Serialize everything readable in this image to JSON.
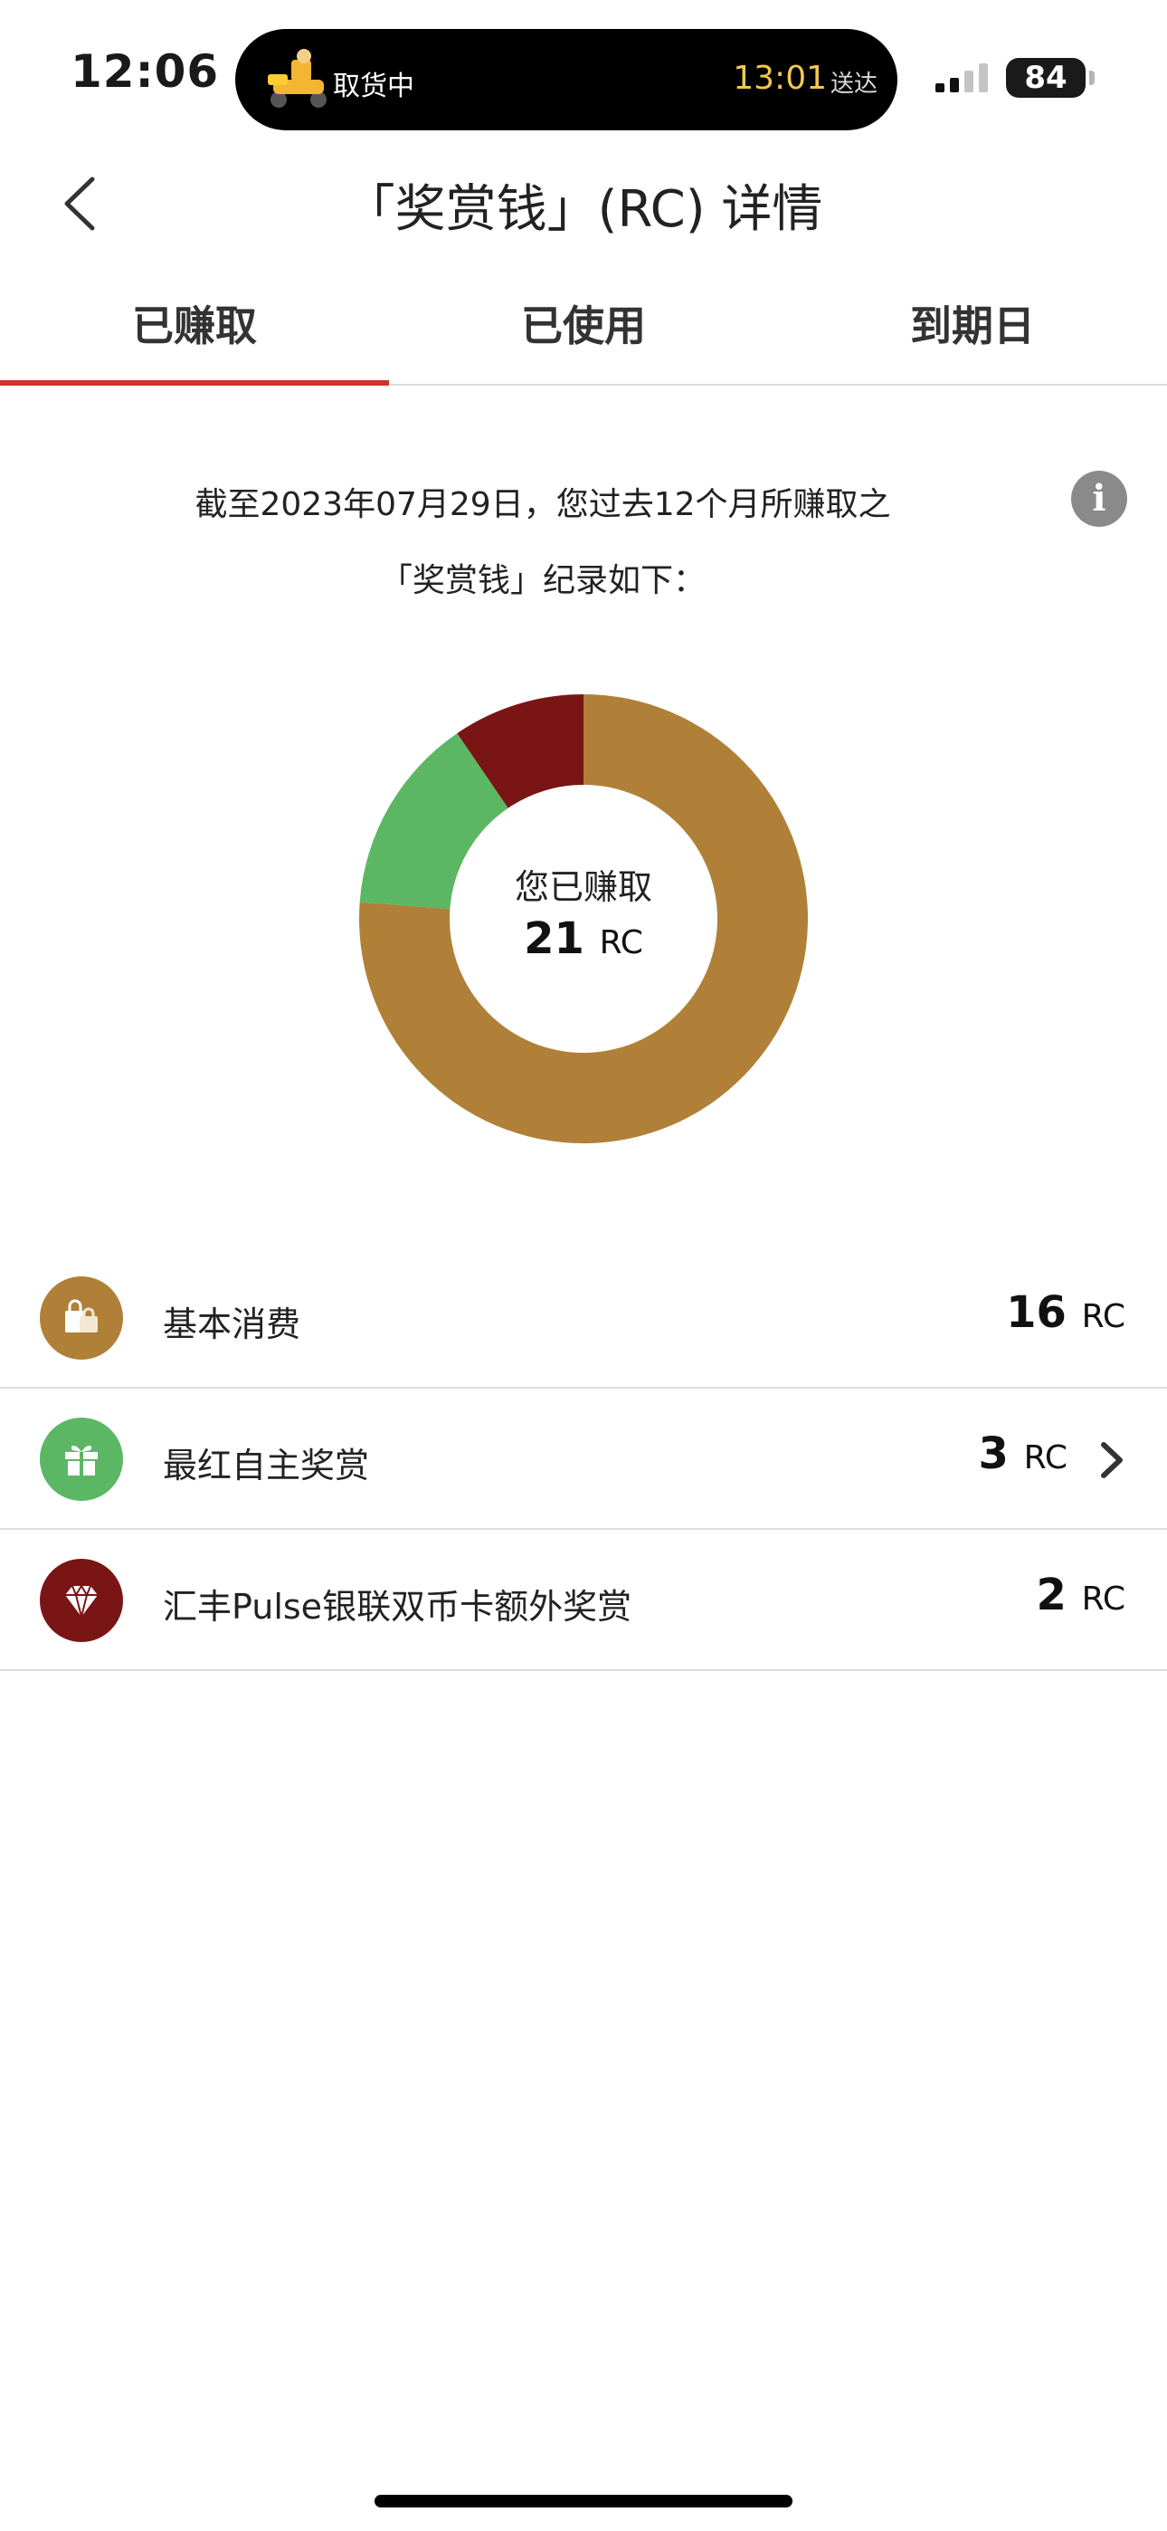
{
  "status_bar": {
    "time": "12:06",
    "activity_text": "取货中",
    "activity_time": "13:01",
    "activity_sub": "送达",
    "battery": "84"
  },
  "header": {
    "title": "「奖赏钱」(RC) 详情",
    "back_icon": "chevron-left-icon"
  },
  "tabs": [
    {
      "label": "已赚取",
      "active": true
    },
    {
      "label": "已使用",
      "active": false
    },
    {
      "label": "到期日",
      "active": false
    }
  ],
  "description": {
    "line1": "截至2023年07月29日，您过去12个月所赚取之",
    "line2": "「奖赏钱」纪录如下：",
    "info_icon": "info-icon"
  },
  "summary": {
    "label": "您已赚取",
    "value": "21",
    "unit": "RC"
  },
  "chart_data": {
    "type": "pie",
    "categories": [
      "基本消费",
      "最红自主奖赏",
      "汇丰Pulse银联双币卡额外奖赏"
    ],
    "values": [
      16,
      3,
      2
    ],
    "colors": [
      "#b08038",
      "#5cb765",
      "#7a1515"
    ],
    "donut": true
  },
  "rows": [
    {
      "label": "基本消费",
      "value": "16",
      "unit": "RC",
      "icon": "shopping-bag-icon",
      "color": "#b08038",
      "has_arrow": false
    },
    {
      "label": "最红自主奖赏",
      "value": "3",
      "unit": "RC",
      "icon": "gift-icon",
      "color": "#5cb765",
      "has_arrow": true
    },
    {
      "label": "汇丰Pulse银联双币卡额外奖赏",
      "value": "2",
      "unit": "RC",
      "icon": "diamond-icon",
      "color": "#7a1515",
      "has_arrow": false
    }
  ]
}
